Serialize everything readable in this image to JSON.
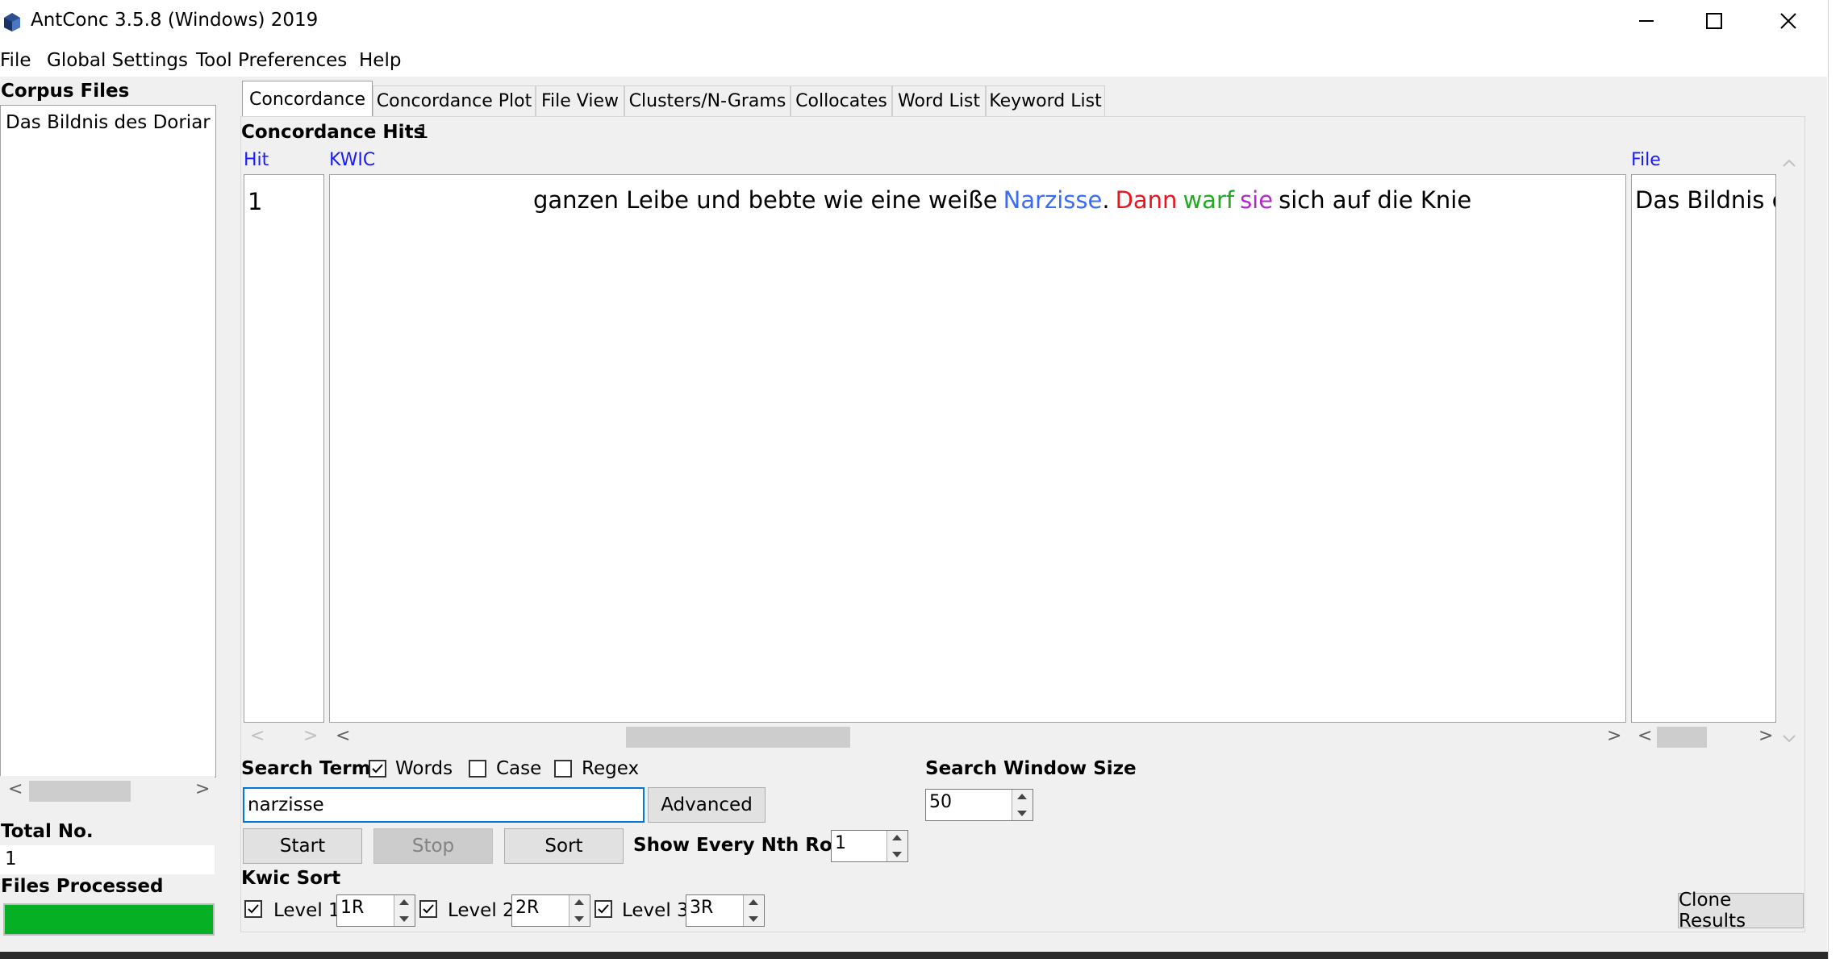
{
  "window": {
    "title": "AntConc 3.5.8 (Windows) 2019",
    "minimize": "—",
    "maximize": "☐",
    "close": "✕"
  },
  "menu": [
    "File",
    "Global Settings",
    "Tool Preferences",
    "Help"
  ],
  "left_panel": {
    "corpus_files_label": "Corpus Files",
    "files": [
      "Das Bildnis des Doriar"
    ],
    "total_no_label": "Total No.",
    "total_no_value": "1",
    "files_processed_label": "Files Processed",
    "progress_fraction": 1.0,
    "progress_color": "#06b025"
  },
  "tabs": [
    "Concordance",
    "Concordance Plot",
    "File View",
    "Clusters/N-Grams",
    "Collocates",
    "Word List",
    "Keyword List"
  ],
  "active_tab": "Concordance",
  "concordance": {
    "hits_label": "Concordance Hits",
    "hits_value": "1",
    "columns": {
      "hit": "Hit",
      "kwic": "KWIC",
      "file": "File"
    },
    "column_header_color": "#1a1aff",
    "rows": [
      {
        "hit": "1",
        "left_context": "ganzen Leibe und bebte wie eine weiße",
        "keyword": "Narzisse",
        "after_keyword": ".",
        "r1": "Dann",
        "r2": "warf",
        "r3": "sie",
        "rest": "sich auf die Knie",
        "file": "Das Bildnis c"
      }
    ],
    "colors": {
      "keyword": "#3a6cf4",
      "r1": "#e8141e",
      "r2": "#22a822",
      "r3": "#b02ac8"
    }
  },
  "search": {
    "label": "Search Term",
    "words_label": "Words",
    "words_checked": true,
    "case_label": "Case",
    "case_checked": false,
    "regex_label": "Regex",
    "regex_checked": false,
    "value": "narzisse",
    "advanced_button": "Advanced",
    "window_size_label": "Search Window Size",
    "window_size_value": "50"
  },
  "buttons": {
    "start": "Start",
    "stop": "Stop",
    "sort": "Sort",
    "clone": "Clone Results"
  },
  "nth_row": {
    "label": "Show Every Nth Row",
    "value": "1"
  },
  "kwic_sort": {
    "label": "Kwic Sort",
    "levels": [
      {
        "label": "Level 1",
        "value": "1R",
        "checked": true
      },
      {
        "label": "Level 2",
        "value": "2R",
        "checked": true
      },
      {
        "label": "Level 3",
        "value": "3R",
        "checked": true
      }
    ]
  },
  "scroll_arrows": {
    "left": "<",
    "right": ">"
  }
}
